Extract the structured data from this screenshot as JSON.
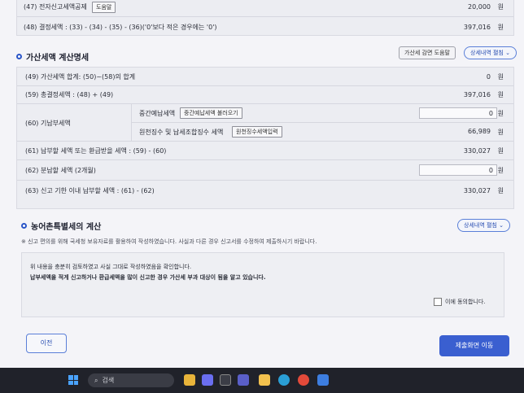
{
  "top_rows": [
    {
      "label": "(47) 전자신고세액공제",
      "help": "도움말",
      "value": "20,000",
      "unit": "원"
    },
    {
      "label": "(48) 결정세액 : (33) - (34) - (35) - (36)('0'보다 적은 경우에는 '0')",
      "value": "397,016",
      "unit": "원"
    }
  ],
  "penalty_section": {
    "title": "가산세액 계산명세",
    "help_button": "가산세 감면 도움말",
    "detail_toggle": "상세내역 펼침",
    "rows": {
      "r49": {
        "label": "(49) 가산세액 합계: (50)~(58)의 합계",
        "value": "0",
        "unit": "원"
      },
      "r59": {
        "label": "(59) 총결정세액 : (48) + (49)",
        "value": "397,016",
        "unit": "원"
      },
      "r60": {
        "label": "(60) 기납부세액",
        "sub1_label": "중간예납세액",
        "sub1_button": "중간예납세액 불러오기",
        "sub1_value": "0",
        "sub2_label": "원천징수 및 납세조합징수 세액",
        "sub2_button": "원천징수세액입력",
        "sub2_value": "66,989",
        "unit": "원"
      },
      "r61": {
        "label": "(61) 납부할 세액 또는 환급받을 세액 : (59) - (60)",
        "value": "330,027",
        "unit": "원"
      },
      "r62": {
        "label": "(62) 분납할 세액 (2개월)",
        "value": "0",
        "unit": "원"
      },
      "r63": {
        "label": "(63) 신고 기한 이내 납부할 세액 : (61) - (62)",
        "value": "330,027",
        "unit": "원"
      }
    }
  },
  "rural_section": {
    "title": "농어촌특별세의 계산",
    "detail_toggle": "상세내역 펼침",
    "notice": "※ 신고 편의를 위해 국세청 보유자료를 활용하여 작성하였습니다. 사실과 다른 경우 신고서를 수정하여 제출하시기 바랍니다."
  },
  "confirm": {
    "line1": "위 내용을 충분히 검토하였고 사실 그대로 작성하였음을 확인합니다.",
    "line2": "납부세액을 적게 신고하거나 환급세액을 많이 신고한 경우 가산세 부과 대상이 됨을 알고 있습니다.",
    "agree": "이에 동의합니다."
  },
  "nav": {
    "prev": "이전",
    "next": "제출화면 이동"
  },
  "taskbar": {
    "search": "검색"
  },
  "colors": {
    "primary": "#3a5fd0",
    "bg": "#f4f4f8"
  }
}
